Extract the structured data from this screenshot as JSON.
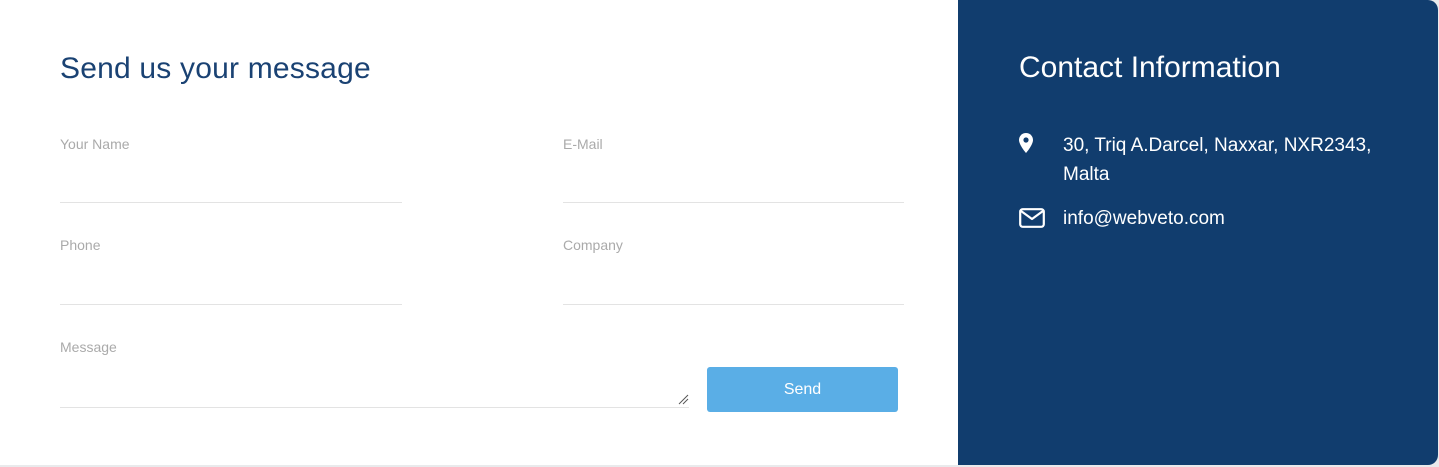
{
  "form": {
    "title": "Send us your message",
    "fields": {
      "name": {
        "label": "Your Name",
        "value": ""
      },
      "email": {
        "label": "E-Mail",
        "value": ""
      },
      "phone": {
        "label": "Phone",
        "value": ""
      },
      "company": {
        "label": "Company",
        "value": ""
      },
      "message": {
        "label": "Message",
        "value": ""
      }
    },
    "send_label": "Send"
  },
  "contact": {
    "title": "Contact Information",
    "address": "30, Triq A.Darcel, Naxxar, NXR2343, Malta",
    "email": "info@webveto.com",
    "icons": {
      "address": "map-pin-icon",
      "email": "envelope-icon"
    }
  },
  "colors": {
    "panel_bg": "#113d6e",
    "title": "#1a4273",
    "button": "#5aaee6",
    "label": "#aaaaaa"
  }
}
